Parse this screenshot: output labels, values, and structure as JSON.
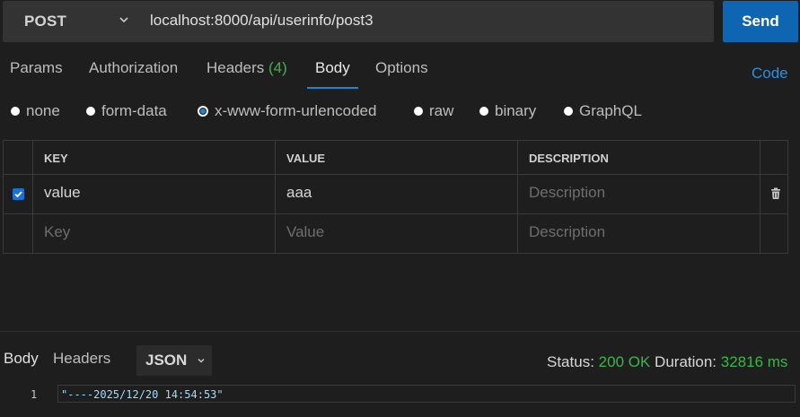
{
  "request": {
    "method": "POST",
    "url": "localhost:8000/api/userinfo/post3",
    "send_label": "Send"
  },
  "tabs": {
    "params": "Params",
    "authorization": "Authorization",
    "headers": "Headers",
    "headers_count": "(4)",
    "body": "Body",
    "options": "Options",
    "active": "Body"
  },
  "code_link": "Code",
  "body_types": {
    "options": [
      "none",
      "form-data",
      "x-www-form-urlencoded",
      "raw",
      "binary",
      "GraphQL"
    ],
    "selected": "x-www-form-urlencoded"
  },
  "table": {
    "headers": [
      "KEY",
      "VALUE",
      "DESCRIPTION"
    ],
    "rows": [
      {
        "checked": true,
        "key": "value",
        "value": "aaa",
        "description_placeholder": "Description"
      }
    ],
    "new_row": {
      "key_placeholder": "Key",
      "value_placeholder": "Value",
      "description_placeholder": "Description"
    }
  },
  "response": {
    "tabs": {
      "body": "Body",
      "headers": "Headers"
    },
    "format": "JSON",
    "status_label": "Status:",
    "status_value": "200 OK",
    "duration_label": "Duration:",
    "duration_value": "32816 ms",
    "lines": [
      {
        "num": "1",
        "text": "\"----2025/12/20 14:54:53\""
      }
    ]
  },
  "colors": {
    "accent": "#1f86d6",
    "send_button": "#0e66b3",
    "success": "#3bb54a"
  }
}
